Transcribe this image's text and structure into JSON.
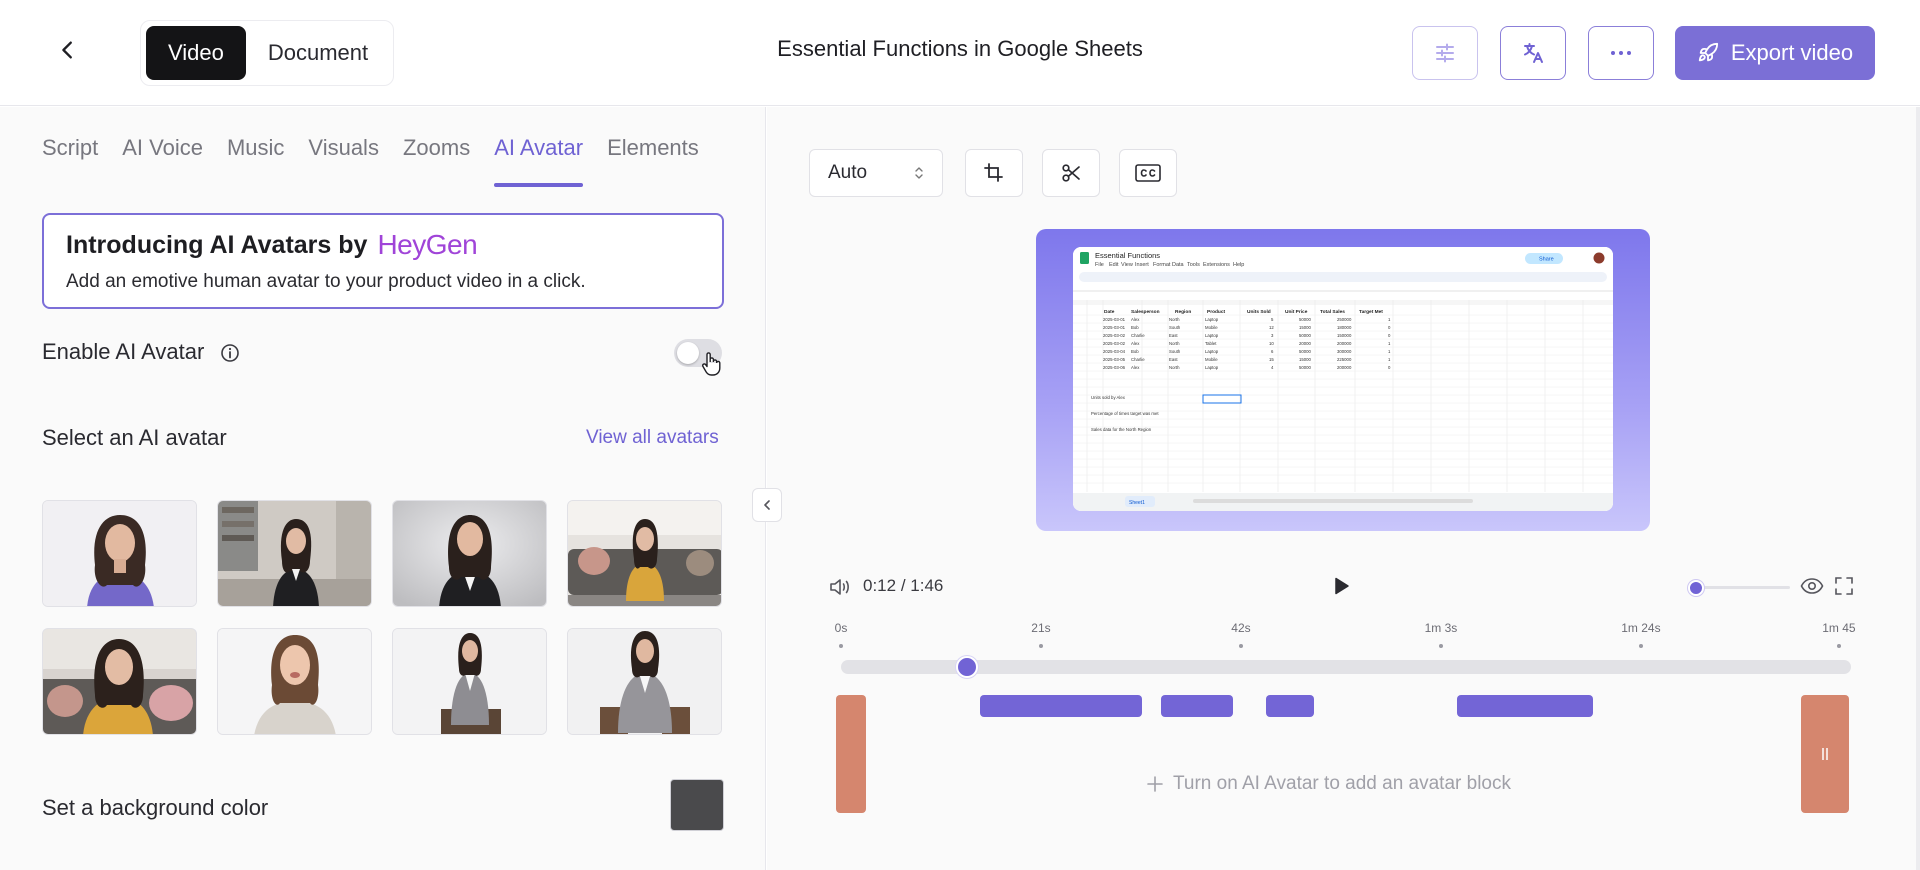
{
  "header": {
    "modes": [
      "Video",
      "Document"
    ],
    "active_mode": "Video",
    "title": "Essential Functions in Google Sheets",
    "export_label": "Export video",
    "icons": [
      "back-arrow-icon",
      "sliders-icon",
      "translate-icon",
      "more-icon",
      "rocket-icon"
    ]
  },
  "left": {
    "tabs": [
      "Script",
      "AI Voice",
      "Music",
      "Visuals",
      "Zooms",
      "AI Avatar",
      "Elements"
    ],
    "active_tab": "AI Avatar",
    "promo": {
      "title": "Introducing AI Avatars by",
      "brand": "HeyGen",
      "subtitle": "Add an emotive human avatar to your product video in a click."
    },
    "enable_label": "Enable AI Avatar",
    "enable_state": false,
    "select_label": "Select an AI avatar",
    "view_all": "View all avatars",
    "avatar_count": 8,
    "bg_label": "Set a background color",
    "bg_color": "#4a4a4c"
  },
  "right": {
    "aspect_select": "Auto",
    "tools": [
      "crop-icon",
      "scissors-icon",
      "captions-icon"
    ],
    "time_current": "0:12",
    "time_sep": "/",
    "time_total": "1:46",
    "ruler_labels": [
      "0s",
      "21s",
      "42s",
      "1m 3s",
      "1m 24s",
      "1m 45"
    ],
    "avatar_hint": "Turn on AI Avatar to add an avatar block",
    "sheet": {
      "title": "Essential Functions",
      "menu": [
        "File",
        "Edit",
        "View",
        "Insert",
        "Format",
        "Data",
        "Tools",
        "Extensions",
        "Help"
      ],
      "share": "Share",
      "headers": [
        "Date",
        "Salesperson",
        "Region",
        "Product",
        "Units Sold",
        "Unit Price",
        "Total Sales",
        "Target Met"
      ],
      "rows": [
        [
          "2025-03-01",
          "Alex",
          "North",
          "Laptop",
          "5",
          "50000",
          "250000",
          "1"
        ],
        [
          "2025-03-01",
          "Bob",
          "South",
          "Mobile",
          "12",
          "15000",
          "180000",
          "0"
        ],
        [
          "2025-03-02",
          "Charlie",
          "East",
          "Laptop",
          "3",
          "50000",
          "150000",
          "0"
        ],
        [
          "2025-03-02",
          "Alex",
          "North",
          "Tablet",
          "10",
          "20000",
          "200000",
          "1"
        ],
        [
          "2025-03-04",
          "Bob",
          "South",
          "Laptop",
          "6",
          "50000",
          "300000",
          "1"
        ],
        [
          "2025-03-05",
          "Charlie",
          "East",
          "Mobile",
          "15",
          "15000",
          "225000",
          "1"
        ],
        [
          "2025-03-06",
          "Alex",
          "North",
          "Laptop",
          "4",
          "50000",
          "200000",
          "0"
        ]
      ],
      "notes": [
        "Units sold by Alex",
        "Percentage of times target was met",
        "Sales data for the North Region"
      ],
      "sheet_tab": "Sheet1"
    }
  },
  "colors": {
    "accent": "#7163d5",
    "handle": "#d5866e",
    "active_mode_bg": "#141416"
  }
}
